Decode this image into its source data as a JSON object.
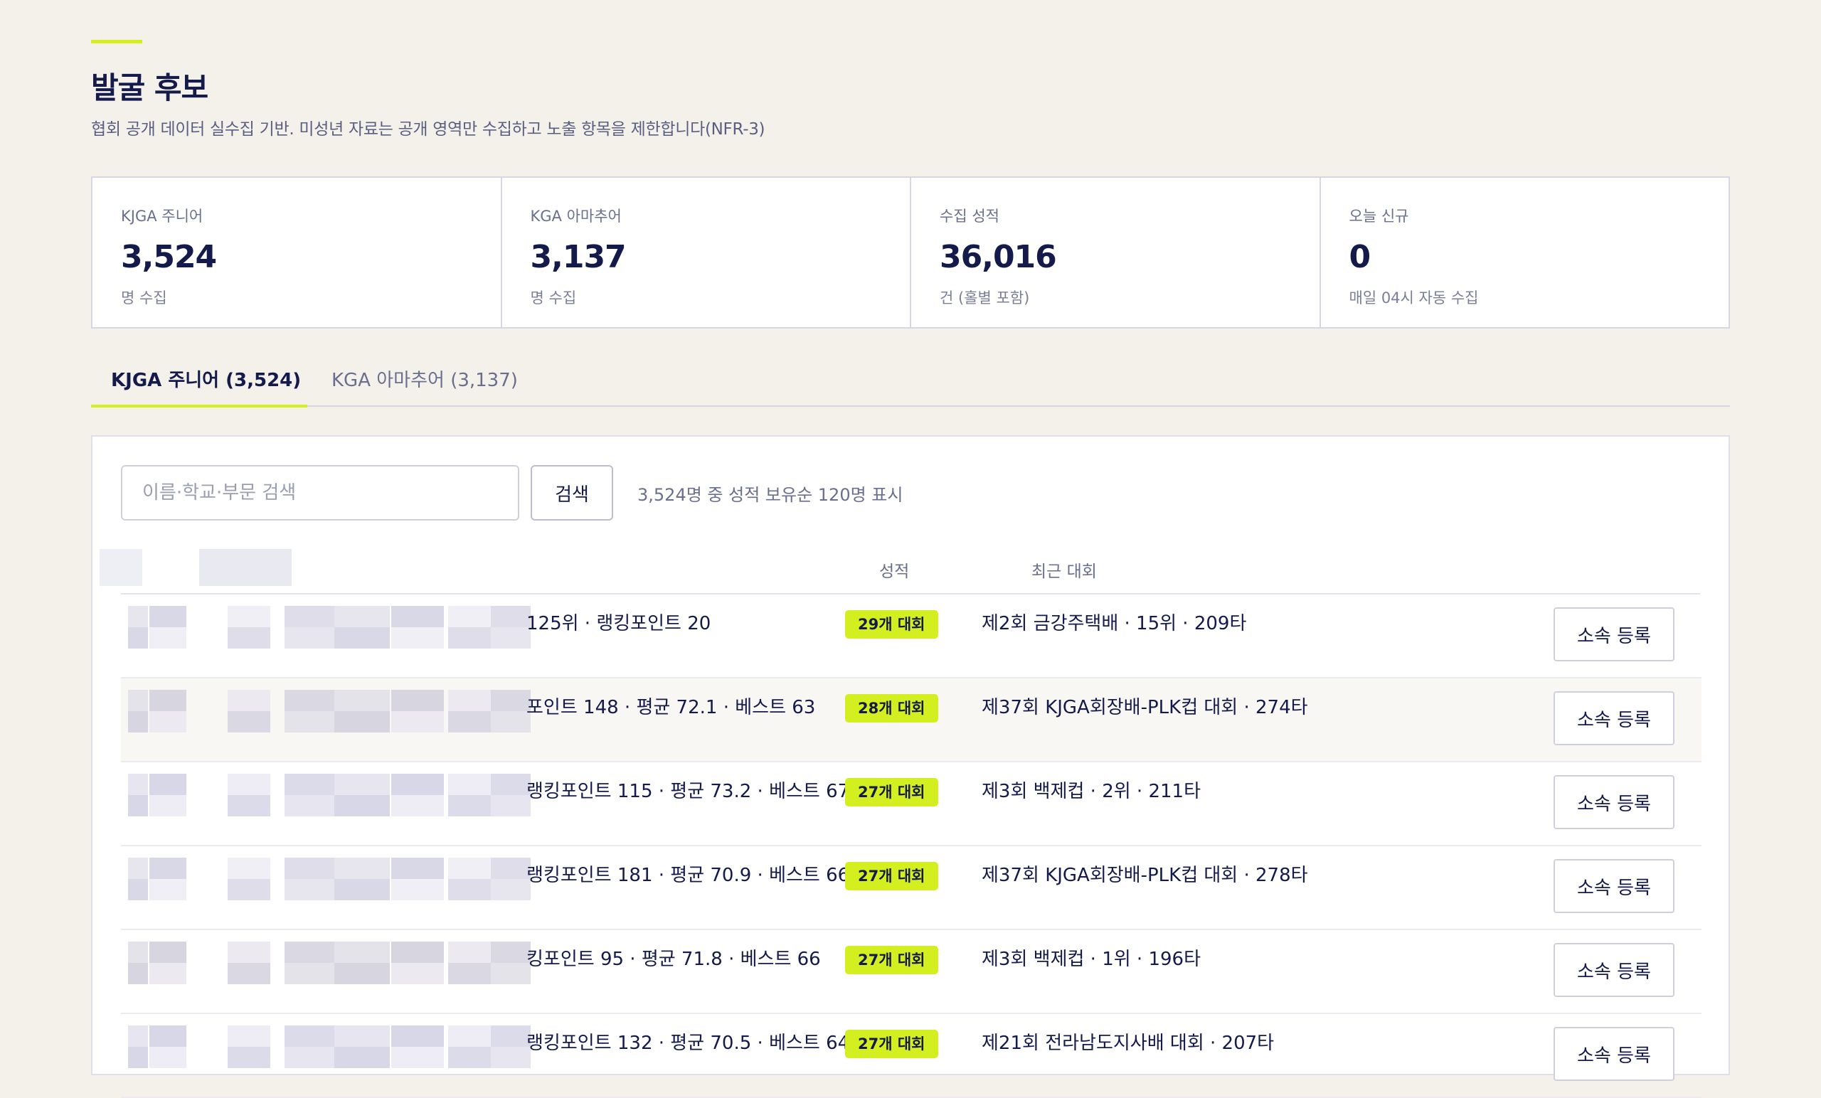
{
  "page": {
    "title": "발굴 후보",
    "subtitle": "협회 공개 데이터 실수집 기반. 미성년 자료는 공개 영역만 수집하고 노출 항목을 제한합니다(NFR-3)"
  },
  "stats": [
    {
      "label": "KJGA 주니어",
      "value": "3,524",
      "sub": "명 수집"
    },
    {
      "label": "KGA 아마추어",
      "value": "3,137",
      "sub": "명 수집"
    },
    {
      "label": "수집 성적",
      "value": "36,016",
      "sub": "건 (홀별 포함)"
    },
    {
      "label": "오늘 신규",
      "value": "0",
      "sub": "매일 04시 자동 수집"
    }
  ],
  "tabs": [
    {
      "label": "KJGA 주니어 (3,524)",
      "active": true
    },
    {
      "label": "KGA 아마추어 (3,137)",
      "active": false
    }
  ],
  "search": {
    "placeholder": "이름·학교·부문 검색",
    "button_label": "검색",
    "result_count": "3,524명 중 성적 보유순 120명 표시"
  },
  "table": {
    "headers": {
      "record": "성적",
      "recent": "최근 대회"
    },
    "rows": [
      {
        "rank_text": "125위 · 랭킹포인트 20",
        "badge": "29개 대회",
        "recent": "제2회 금강주택배 · 15위 · 209타",
        "action": "소속 등록"
      },
      {
        "rank_text": "포인트 148 · 평균 72.1 · 베스트 63",
        "badge": "28개 대회",
        "recent": "제37회 KJGA회장배-PLK컵 대회 · 274타",
        "action": "소속 등록"
      },
      {
        "rank_text": "랭킹포인트 115 · 평균 73.2 · 베스트 67",
        "badge": "27개 대회",
        "recent": "제3회 백제컵 · 2위 · 211타",
        "action": "소속 등록"
      },
      {
        "rank_text": "랭킹포인트 181 · 평균 70.9 · 베스트 66",
        "badge": "27개 대회",
        "recent": "제37회 KJGA회장배-PLK컵 대회 · 278타",
        "action": "소속 등록"
      },
      {
        "rank_text": "킹포인트 95 · 평균 71.8 · 베스트 66",
        "badge": "27개 대회",
        "recent": "제3회 백제컵 · 1위 · 196타",
        "action": "소속 등록"
      },
      {
        "rank_text": "랭킹포인트 132 · 평균 70.5 · 베스트 64",
        "badge": "27개 대회",
        "recent": "제21회 전라남도지사배 대회 · 207타",
        "action": "소속 등록"
      }
    ]
  },
  "colors": {
    "accent": "#d4ef1f",
    "text": "#141a4a",
    "muted": "#6a6f8e",
    "background": "#f4f1ea"
  }
}
